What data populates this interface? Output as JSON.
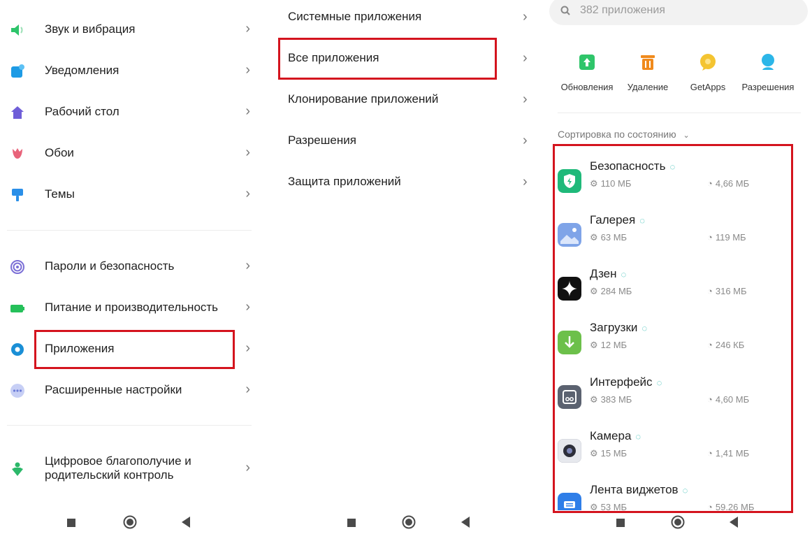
{
  "panel1": {
    "items": [
      {
        "icon": "speaker-icon",
        "label": "Звук и вибрация",
        "color": "#2ec46b"
      },
      {
        "icon": "notification-icon",
        "label": "Уведомления",
        "color": "#1e9be5"
      },
      {
        "icon": "home-icon",
        "label": "Рабочий стол",
        "color": "#6f5ed8"
      },
      {
        "icon": "tulip-icon",
        "label": "Обои",
        "color": "#e8637a"
      },
      {
        "icon": "brush-icon",
        "label": "Темы",
        "color": "#2a8fe8"
      },
      {
        "icon": "fingerprint-icon",
        "label": "Пароли и безопасность",
        "color": "#7b6fd6"
      },
      {
        "icon": "battery-icon",
        "label": "Питание и производительность",
        "color": "#25c05a"
      },
      {
        "icon": "gear-icon",
        "label": "Приложения",
        "color": "#1a8fd6"
      },
      {
        "icon": "dots-icon",
        "label": "Расширенные настройки",
        "color": "#9aa7e8"
      },
      {
        "icon": "wellbeing-icon",
        "label_line1": "Цифровое благополучие и",
        "label_line2": "родительский контроль",
        "color": "#2cb86a"
      }
    ]
  },
  "panel2": {
    "items": [
      {
        "label": "Системные приложения"
      },
      {
        "label": "Все приложения"
      },
      {
        "label": "Клонирование приложений"
      },
      {
        "label": "Разрешения"
      },
      {
        "label": "Защита приложений"
      }
    ]
  },
  "panel3": {
    "search_placeholder": "382 приложения",
    "quick_actions": [
      {
        "icon": "update-icon",
        "label": "Обновления",
        "color": "#2fc56a"
      },
      {
        "icon": "trash-icon",
        "label": "Удаление",
        "color": "#f08a1c"
      },
      {
        "icon": "getapps-icon",
        "label": "GetApps",
        "color": "#f4c431"
      },
      {
        "icon": "permissions-icon",
        "label": "Разрешения",
        "color": "#2cb6e8"
      }
    ],
    "sort_label": "Сортировка по состоянию",
    "apps": [
      {
        "name": "Безопасность",
        "size": "110 МБ",
        "cache": "4,66 МБ",
        "color": "#1fb97a",
        "icon": "shield-icon"
      },
      {
        "name": "Галерея",
        "size": "63 МБ",
        "cache": "119 МБ",
        "color": "#7fa4e8",
        "icon": "gallery-icon"
      },
      {
        "name": "Дзен",
        "size": "284 МБ",
        "cache": "316 МБ",
        "color": "#111111",
        "icon": "zen-icon"
      },
      {
        "name": "Загрузки",
        "size": "12 МБ",
        "cache": "246 КБ",
        "color": "#6cc04a",
        "icon": "download-icon"
      },
      {
        "name": "Интерфейс",
        "size": "383 МБ",
        "cache": "4,60 МБ",
        "color": "#5b6270",
        "icon": "interface-icon"
      },
      {
        "name": "Камера",
        "size": "15 МБ",
        "cache": "1,41 МБ",
        "color": "#e7e9ee",
        "icon": "camera-icon"
      },
      {
        "name": "Лента виджетов",
        "size": "53 МБ",
        "cache": "59,26 МБ",
        "color": "#2f7ee8",
        "icon": "widgets-icon"
      }
    ]
  },
  "highlight_color": "#d4141e"
}
